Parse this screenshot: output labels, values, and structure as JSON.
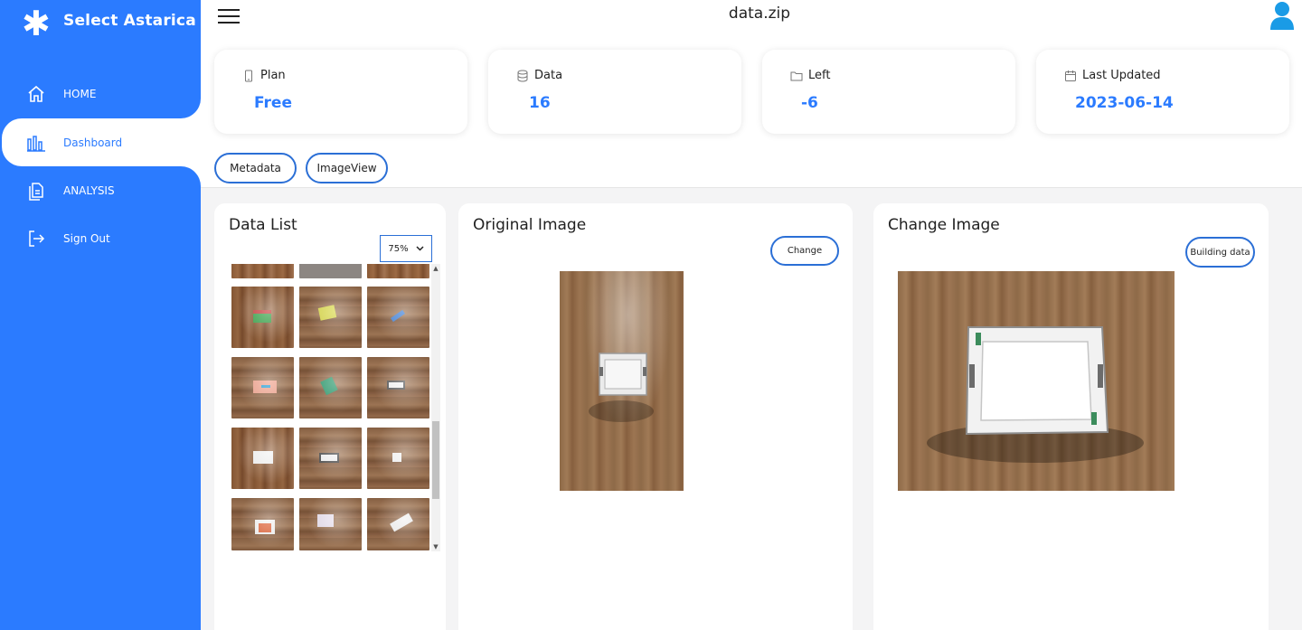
{
  "brand": {
    "name": "Select Astarica",
    "logo_icon": "asterisk-logo-icon"
  },
  "sidebar": {
    "items": [
      {
        "label": "HOME",
        "icon": "home-icon"
      },
      {
        "label": "Dashboard",
        "icon": "bar-chart-icon",
        "active": true
      },
      {
        "label": "ANALYSIS",
        "icon": "documents-icon"
      },
      {
        "label": "Sign Out",
        "icon": "sign-out-icon"
      }
    ]
  },
  "header": {
    "title": "data.zip",
    "menu_icon": "hamburger-menu-icon",
    "user_icon": "user-avatar-icon"
  },
  "stats": [
    {
      "label": "Plan",
      "value": "Free",
      "icon": "phone-icon"
    },
    {
      "label": "Data",
      "value": "16",
      "icon": "database-icon"
    },
    {
      "label": "Left",
      "value": "-6",
      "icon": "folder-icon"
    },
    {
      "label": "Last Updated",
      "value": "2023-06-14",
      "icon": "calendar-icon"
    }
  ],
  "view_tabs": [
    "Metadata",
    "ImageView"
  ],
  "data_list": {
    "title": "Data List",
    "zoom": "75%"
  },
  "original_image": {
    "title": "Original Image",
    "button": "Change"
  },
  "change_image": {
    "title": "Change Image",
    "button": "Building data"
  },
  "colors": {
    "accent": "#2b7bff",
    "button_border": "#2b6fd6"
  }
}
